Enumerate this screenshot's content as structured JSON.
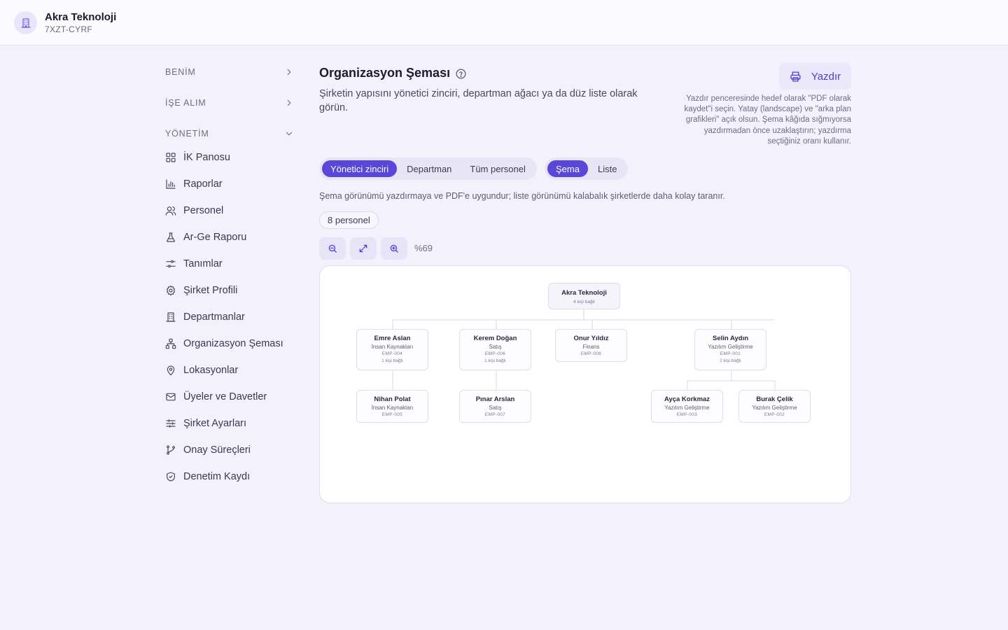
{
  "header": {
    "company_name": "Akra Teknoloji",
    "company_code": "7XZT-CYRF",
    "logo_icon": "building-icon"
  },
  "sidebar": {
    "sections": [
      {
        "label": "BENİM",
        "state": "collapsed"
      },
      {
        "label": "İŞE ALIM",
        "state": "collapsed"
      },
      {
        "label": "YÖNETİM",
        "state": "expanded"
      }
    ],
    "items": [
      {
        "label": "İK Panosu",
        "icon": "dashboard-grid-icon"
      },
      {
        "label": "Raporlar",
        "icon": "bar-chart-icon"
      },
      {
        "label": "Personel",
        "icon": "users-icon"
      },
      {
        "label": "Ar-Ge Raporu",
        "icon": "flask-icon"
      },
      {
        "label": "Tanımlar",
        "icon": "toggles-icon"
      },
      {
        "label": "Şirket Profili",
        "icon": "gear-icon"
      },
      {
        "label": "Departmanlar",
        "icon": "building-icon"
      },
      {
        "label": "Organizasyon Şeması",
        "icon": "org-chart-icon"
      },
      {
        "label": "Lokasyonlar",
        "icon": "map-pin-icon"
      },
      {
        "label": "Üyeler ve Davetler",
        "icon": "mail-icon"
      },
      {
        "label": "Şirket Ayarları",
        "icon": "sliders-icon"
      },
      {
        "label": "Onay Süreçleri",
        "icon": "git-branch-icon"
      },
      {
        "label": "Denetim Kaydı",
        "icon": "shield-check-icon"
      }
    ]
  },
  "main": {
    "title": "Organizasyon Şeması",
    "subtitle": "Şirketin yapısını yönetici zinciri, departman ağacı ya da düz liste olarak görün.",
    "print_label": "Yazdır",
    "print_hint": "Yazdır penceresinde hedef olarak \"PDF olarak kaydet\"i seçin. Yatay (landscape) ve \"arka plan grafikleri\" açık olsun. Şema kâğıda sığmıyorsa yazdırmadan önce uzaklaştırın; yazdırma seçtiğiniz oranı kullanır.",
    "view_modes": [
      {
        "label": "Yönetici zinciri",
        "active": true
      },
      {
        "label": "Departman",
        "active": false
      },
      {
        "label": "Tüm personel",
        "active": false
      }
    ],
    "display_modes": [
      {
        "label": "Şema",
        "active": true
      },
      {
        "label": "Liste",
        "active": false
      }
    ],
    "note": "Şema görünümü yazdırmaya ve PDF'e uygundur; liste görünümü kalabalık şirketlerde daha kolay taranır.",
    "count_badge": "8 personel",
    "zoom_level": "%69"
  },
  "org_chart": {
    "root": {
      "name": "Akra Teknoloji",
      "reports": "4 kişi bağlı"
    },
    "people": [
      {
        "name": "Emre Aslan",
        "dept": "İnsan Kaynakları",
        "code": "EMP-004",
        "reports": "1 kişi bağlı"
      },
      {
        "name": "Kerem Doğan",
        "dept": "Satış",
        "code": "EMP-006",
        "reports": "1 kişi bağlı"
      },
      {
        "name": "Onur Yıldız",
        "dept": "Finans",
        "code": "EMP-008",
        "reports": ""
      },
      {
        "name": "Selin Aydın",
        "dept": "Yazılım Geliştirme",
        "code": "EMP-001",
        "reports": "2 kişi bağlı"
      },
      {
        "name": "Nihan Polat",
        "dept": "İnsan Kaynakları",
        "code": "EMP-005",
        "reports": ""
      },
      {
        "name": "Pınar Arslan",
        "dept": "Satış",
        "code": "EMP-007",
        "reports": ""
      },
      {
        "name": "Ayça Korkmaz",
        "dept": "Yazılım Geliştirme",
        "code": "EMP-003",
        "reports": ""
      },
      {
        "name": "Burak Çelik",
        "dept": "Yazılım Geliştirme",
        "code": "EMP-002",
        "reports": ""
      }
    ]
  },
  "colors": {
    "accent": "#5a46d8",
    "background": "#f3f2fc"
  }
}
